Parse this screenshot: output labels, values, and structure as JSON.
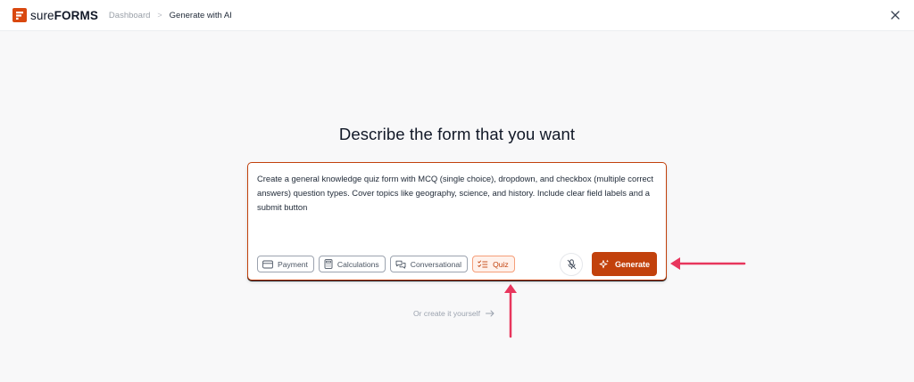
{
  "header": {
    "logo_text_light": "sure",
    "logo_text_bold": "FORMS",
    "breadcrumb": {
      "dashboard": "Dashboard",
      "separator": ">",
      "current": "Generate with AI"
    },
    "close_icon": "close-icon"
  },
  "main": {
    "heading": "Describe the form that you want",
    "prompt": "Create a general knowledge quiz form with MCQ (single choice), dropdown, and checkbox (multiple correct answers) question types. Cover topics like geography, science, and history. Include clear field labels and a submit button",
    "chips": [
      {
        "label": "Payment",
        "icon": "credit-card-icon",
        "active": false
      },
      {
        "label": "Calculations",
        "icon": "calculator-icon",
        "active": false
      },
      {
        "label": "Conversational",
        "icon": "chat-icon",
        "active": false
      },
      {
        "label": "Quiz",
        "icon": "checklist-icon",
        "active": true
      }
    ],
    "mic_icon": "mic-off-icon",
    "generate_label": "Generate",
    "manual_link": "Or create it yourself"
  },
  "colors": {
    "brand": "#c2410c",
    "annotation_arrow": "#e8365d"
  }
}
